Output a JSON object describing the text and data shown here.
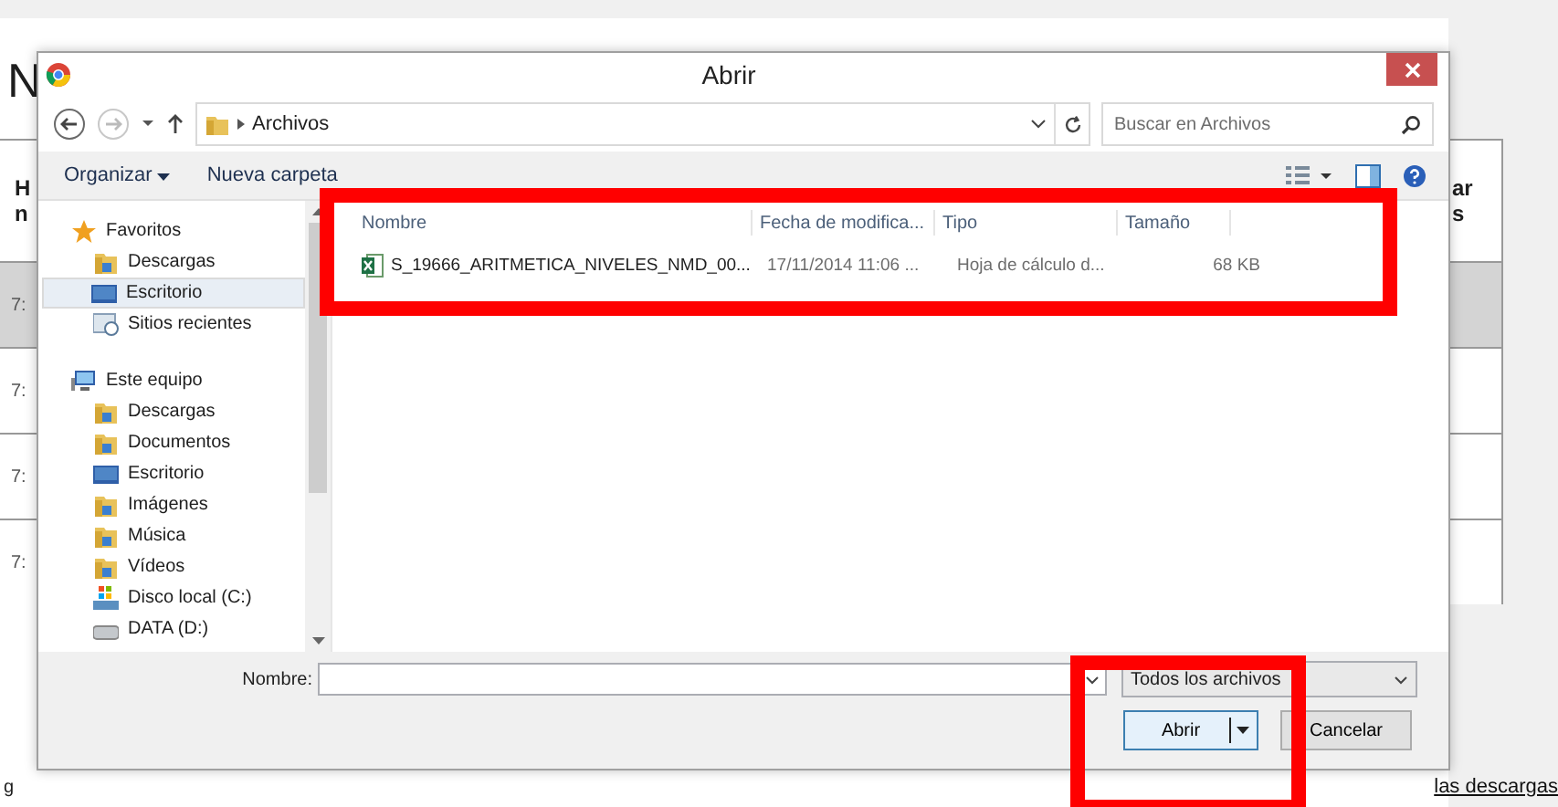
{
  "background": {
    "heading_fragment": "N",
    "header_left": [
      "H",
      "n"
    ],
    "header_right": [
      "ar",
      "s"
    ],
    "rows": [
      {
        "left": "7:",
        "selected": true
      },
      {
        "left": "7:",
        "selected": false
      },
      {
        "left": "7:",
        "selected": false
      },
      {
        "left": "7:",
        "selected": false
      }
    ],
    "footer_left": "g",
    "footer_link": "las descargas"
  },
  "dialog": {
    "title": "Abrir",
    "address": "Archivos",
    "search": {
      "placeholder": "Buscar en Archivos"
    },
    "toolbar": [
      "Organizar",
      "Nueva carpeta"
    ],
    "nav": [
      {
        "label": "Favoritos",
        "kind": "star",
        "children": [
          {
            "label": "Descargas",
            "kind": "download",
            "selected": false
          },
          {
            "label": "Escritorio",
            "kind": "desktop",
            "selected": true
          },
          {
            "label": "Sitios recientes",
            "kind": "recent",
            "selected": false
          }
        ]
      },
      {
        "label": "Este equipo",
        "kind": "computer",
        "children": [
          {
            "label": "Descargas",
            "kind": "download",
            "selected": false
          },
          {
            "label": "Documentos",
            "kind": "docs",
            "selected": false
          },
          {
            "label": "Escritorio",
            "kind": "desktop",
            "selected": false
          },
          {
            "label": "Imágenes",
            "kind": "images",
            "selected": false
          },
          {
            "label": "Música",
            "kind": "music",
            "selected": false
          },
          {
            "label": "Vídeos",
            "kind": "video",
            "selected": false
          },
          {
            "label": "Disco local (C:)",
            "kind": "drive",
            "selected": false
          },
          {
            "label": "DATA (D:)",
            "kind": "disk",
            "selected": false
          }
        ]
      }
    ],
    "columns": [
      "Nombre",
      "Fecha de modifica...",
      "Tipo",
      "Tamaño"
    ],
    "files": [
      {
        "name": "S_19666_ARITMETICA_NIVELES_NMD_00...",
        "date": "17/11/2014 11:06 ...",
        "type": "Hoja de cálculo d...",
        "size": "68 KB"
      }
    ],
    "filename_label": "Nombre:",
    "filetype": "Todos los archivos",
    "buttons": [
      "Abrir",
      "Cancelar"
    ]
  },
  "annotations": [
    {
      "kind": "box"
    },
    {
      "kind": "box"
    }
  ]
}
